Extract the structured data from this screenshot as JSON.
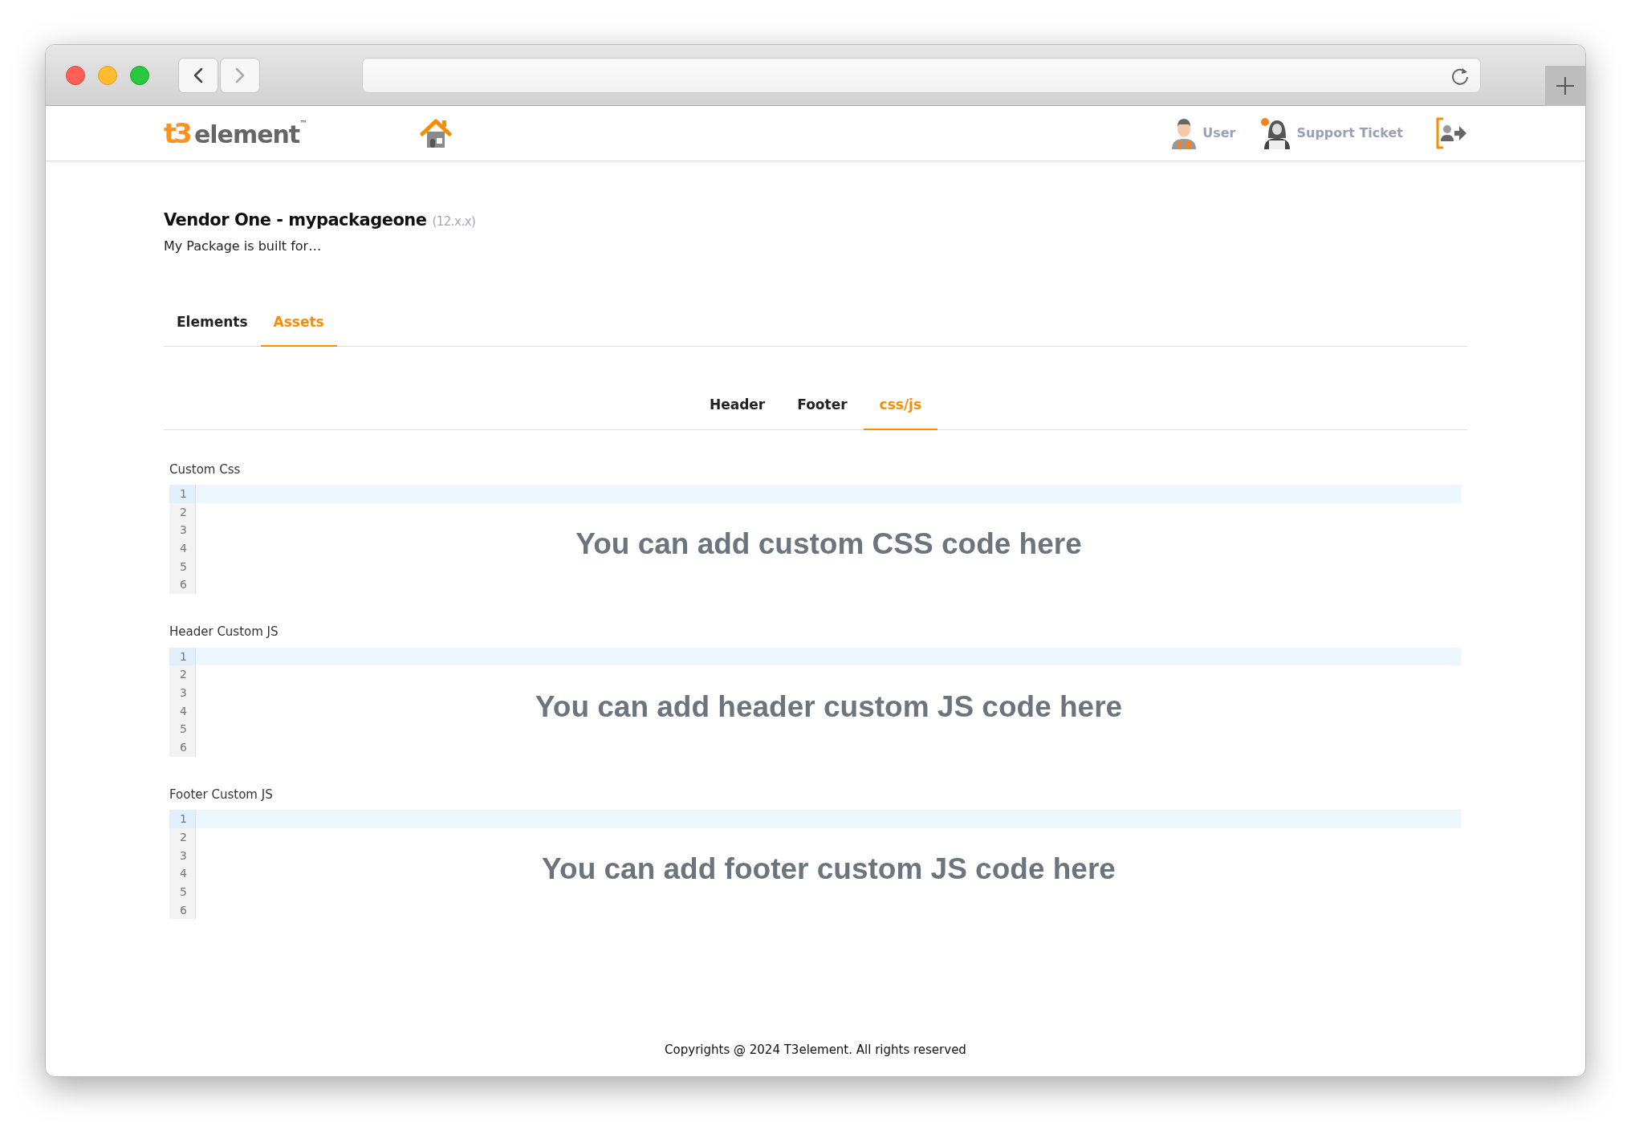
{
  "browser": {
    "nav_buttons": [
      {
        "kind": "back",
        "disabled": false
      },
      {
        "kind": "forward",
        "disabled": true
      }
    ]
  },
  "navbar": {
    "logo": {
      "mark": "t3",
      "text": "element",
      "tm": "™"
    },
    "menu": [
      {
        "kind": "user",
        "label": "User"
      },
      {
        "kind": "support",
        "label": "Support Ticket"
      }
    ]
  },
  "package": {
    "title": "Vendor One - mypackageone",
    "version": "(12.x.x)",
    "description": "My Package is built for…"
  },
  "tabs": [
    {
      "label": "Elements",
      "selected": false
    },
    {
      "label": "Assets",
      "selected": true
    }
  ],
  "subtabs": [
    {
      "label": "Header",
      "selected": false
    },
    {
      "label": "Footer",
      "selected": false
    },
    {
      "label": "css/js",
      "selected": true
    }
  ],
  "editors": [
    {
      "label": "Custom Css",
      "placeholder": "You can add custom CSS code here",
      "lines": [
        {
          "number": "1",
          "active": true
        },
        {
          "number": "2",
          "active": false
        },
        {
          "number": "3",
          "active": false
        },
        {
          "number": "4",
          "active": false
        },
        {
          "number": "5",
          "active": false
        },
        {
          "number": "6",
          "active": false
        }
      ]
    },
    {
      "label": "Header Custom JS",
      "placeholder": "You can add header custom JS code here",
      "lines": [
        {
          "number": "1",
          "active": true
        },
        {
          "number": "2",
          "active": false
        },
        {
          "number": "3",
          "active": false
        },
        {
          "number": "4",
          "active": false
        },
        {
          "number": "5",
          "active": false
        },
        {
          "number": "6",
          "active": false
        }
      ]
    },
    {
      "label": "Footer Custom JS",
      "placeholder": "You can add footer custom JS code here",
      "lines": [
        {
          "number": "1",
          "active": true
        },
        {
          "number": "2",
          "active": false
        },
        {
          "number": "3",
          "active": false
        },
        {
          "number": "4",
          "active": false
        },
        {
          "number": "5",
          "active": false
        },
        {
          "number": "6",
          "active": false
        }
      ]
    }
  ],
  "footer": {
    "text": "Copyrights @ 2024 T3element. All rights reserved"
  }
}
